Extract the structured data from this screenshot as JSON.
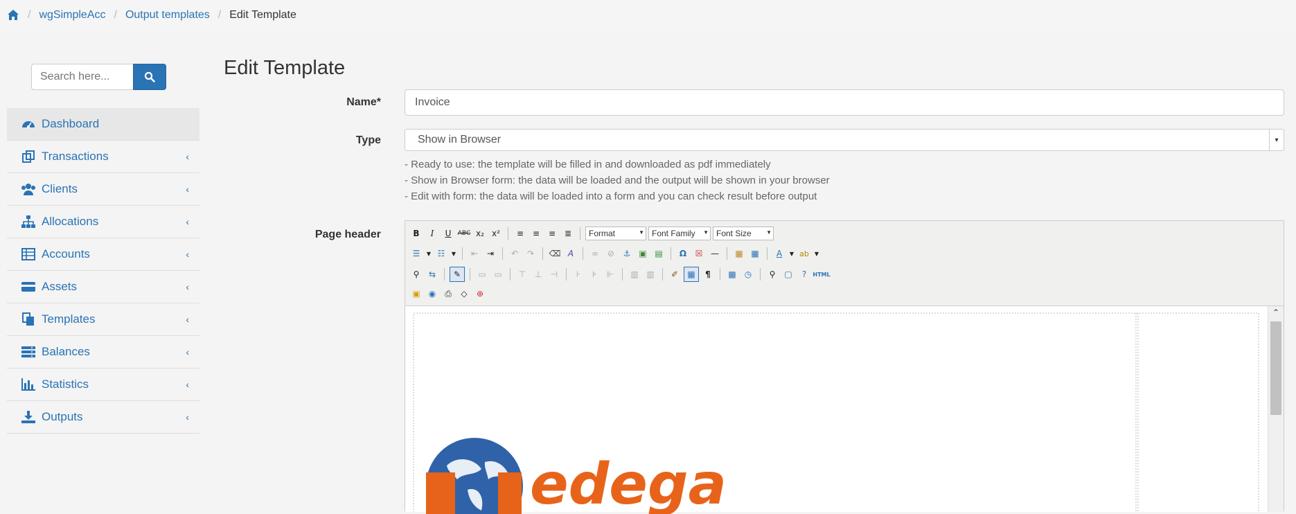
{
  "breadcrumb": {
    "items": [
      "wgSimpleAcc",
      "Output templates"
    ],
    "active": "Edit Template"
  },
  "search": {
    "placeholder": "Search here..."
  },
  "sidebar": {
    "items": [
      {
        "label": "Dashboard",
        "icon": "dashboard-icon"
      },
      {
        "label": "Transactions",
        "icon": "transactions-icon"
      },
      {
        "label": "Clients",
        "icon": "clients-icon"
      },
      {
        "label": "Allocations",
        "icon": "allocations-icon"
      },
      {
        "label": "Accounts",
        "icon": "accounts-icon"
      },
      {
        "label": "Assets",
        "icon": "assets-icon"
      },
      {
        "label": "Templates",
        "icon": "templates-icon"
      },
      {
        "label": "Balances",
        "icon": "balances-icon"
      },
      {
        "label": "Statistics",
        "icon": "statistics-icon"
      },
      {
        "label": "Outputs",
        "icon": "outputs-icon"
      }
    ]
  },
  "page": {
    "title": "Edit Template"
  },
  "form": {
    "name_label": "Name*",
    "name_value": "Invoice",
    "type_label": "Type",
    "type_value": "Show in Browser",
    "help": [
      "- Ready to use: the template will be filled in and downloaded as pdf immediately",
      "- Show in Browser form: the data will be loaded and the output will be shown in your browser",
      "- Edit with form: the data will be loaded into a form and you can check result before output"
    ],
    "header_label": "Page header"
  },
  "editor": {
    "format": "Format",
    "font_family": "Font Family",
    "font_size": "Font Size",
    "html_label": "HTML",
    "logo_text": "edega"
  },
  "colors": {
    "link": "#2a73b5",
    "accent": "#2a73b5",
    "logo": "#e8631a"
  }
}
